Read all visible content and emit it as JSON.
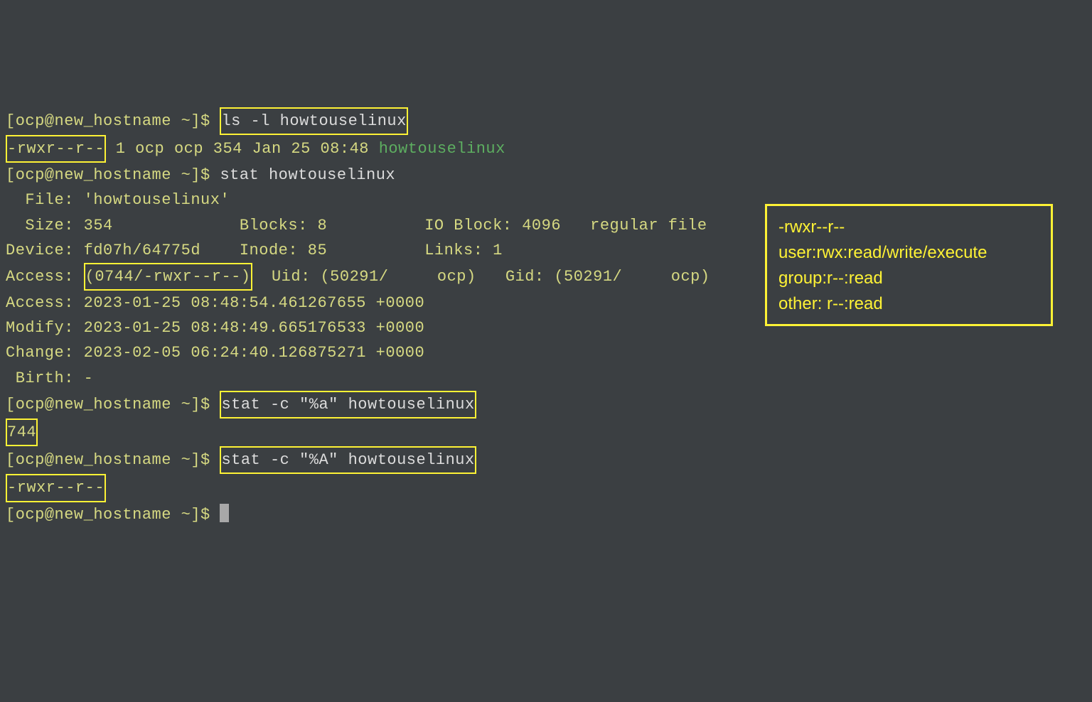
{
  "prompt": "[ocp@new_hostname ~]$ ",
  "cmd1": "ls -l howtouselinux",
  "ls_perms": "-rwxr--r--",
  "ls_rest_a": " 1 ocp ocp 354 Jan 25 08:48 ",
  "ls_filename": "howtouselinux",
  "cmd2": "stat howtouselinux",
  "stat": {
    "file": "  File: 'howtouselinux'",
    "size": "  Size: 354             Blocks: 8          IO Block: 4096   regular file",
    "device": "Device: fd07h/64775d    Inode: 85          Links: 1",
    "access_pre": "Access: ",
    "access_perm": "(0744/-rwxr--r--)",
    "access_post": "  Uid: (50291/     ocp)   Gid: (50291/     ocp)",
    "access_time": "Access: 2023-01-25 08:48:54.461267655 +0000",
    "modify": "Modify: 2023-01-25 08:48:49.665176533 +0000",
    "change": "Change: 2023-02-05 06:24:40.126875271 +0000",
    "birth": " Birth: -"
  },
  "cmd3": "stat -c \"%a\" howtouselinux",
  "out3": "744",
  "cmd4": "stat -c \"%A\" howtouselinux",
  "out4": "-rwxr--r--",
  "legend": {
    "l1": "-rwxr--r--",
    "l2": "user:rwx:read/write/execute",
    "l3": "group:r--:read",
    "l4": "other: r--:read"
  }
}
